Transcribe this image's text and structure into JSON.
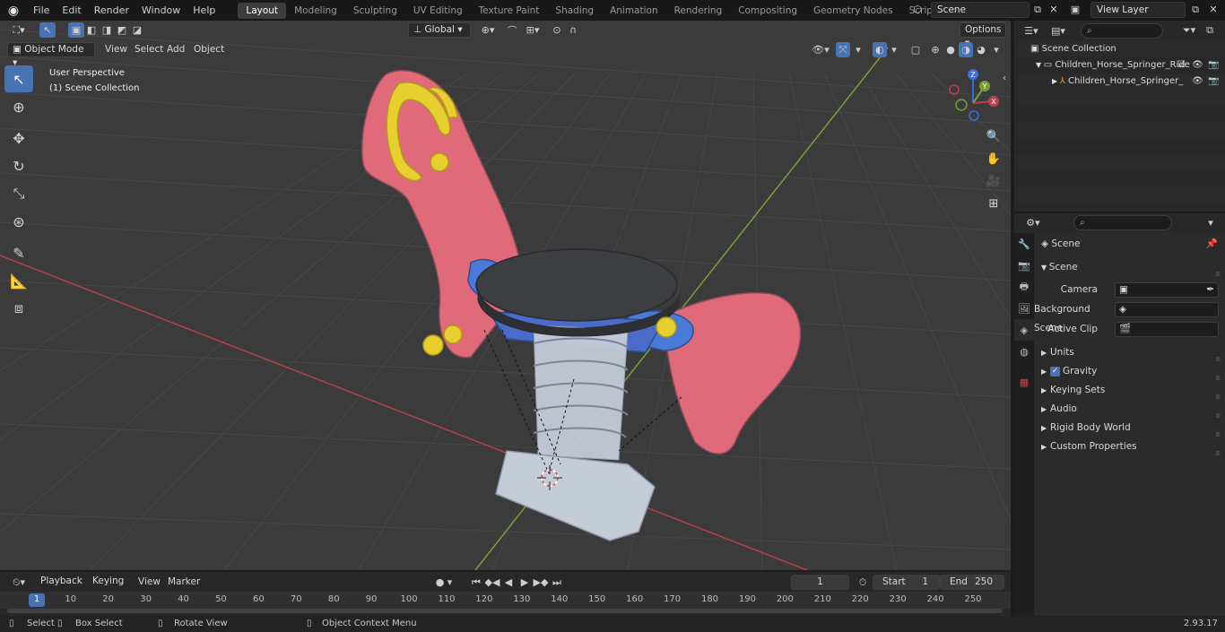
{
  "topbar": {
    "menus": [
      "File",
      "Edit",
      "Render",
      "Window",
      "Help"
    ],
    "workspaces": [
      "Layout",
      "Modeling",
      "Sculpting",
      "UV Editing",
      "Texture Paint",
      "Shading",
      "Animation",
      "Rendering",
      "Compositing",
      "Geometry Nodes",
      "Scripting"
    ],
    "active_workspace": "Layout",
    "add_label": "+",
    "scene": "Scene",
    "view_layer": "View Layer"
  },
  "viewport": {
    "mode": "Object Mode",
    "menus": [
      "View",
      "Select",
      "Add",
      "Object"
    ],
    "transform_orientation": "Global",
    "options_label": "Options",
    "overlay_line1": "User Perspective",
    "overlay_line2": "(1) Scene Collection",
    "gizmo_axes": {
      "z": "Z",
      "y": "Y",
      "x": "X"
    },
    "tools": [
      "select-box",
      "cursor",
      "move",
      "rotate",
      "scale",
      "transform",
      "annotate",
      "measure",
      "add-cube"
    ]
  },
  "outliner": {
    "root": "Scene Collection",
    "items": [
      {
        "label": "Children_Horse_Springer_Ride",
        "level": 1
      },
      {
        "label": "Children_Horse_Springer_",
        "level": 2
      }
    ]
  },
  "properties": {
    "header": "Scene",
    "section": "Scene",
    "fields": [
      {
        "label": "Camera",
        "value": ""
      },
      {
        "label": "Background Scene",
        "value": ""
      },
      {
        "label": "Active Clip",
        "value": ""
      }
    ],
    "panels": [
      "Units",
      "Gravity",
      "Keying Sets",
      "Audio",
      "Rigid Body World",
      "Custom Properties"
    ],
    "gravity_checked": true
  },
  "timeline": {
    "menus": [
      "Playback",
      "Keying",
      "View",
      "Marker"
    ],
    "current_frame": "1",
    "start_label": "Start",
    "start": "1",
    "end_label": "End",
    "end": "250",
    "ticks": [
      "1",
      "10",
      "20",
      "30",
      "40",
      "50",
      "60",
      "70",
      "80",
      "90",
      "100",
      "110",
      "120",
      "130",
      "140",
      "150",
      "160",
      "170",
      "180",
      "190",
      "200",
      "210",
      "220",
      "230",
      "240",
      "250"
    ]
  },
  "statusbar": {
    "select": "Select",
    "box_select": "Box Select",
    "rotate_view": "Rotate View",
    "context_menu": "Object Context Menu",
    "version": "2.93.17"
  },
  "colors": {
    "accent": "#4772b3",
    "horse_pink": "#e06a7a",
    "handle_yellow": "#e6cf2e",
    "seat_dark": "#3c3e42",
    "spring_light": "#c4ccd8",
    "x_axis": "#b5404c",
    "y_axis": "#7aa036"
  }
}
